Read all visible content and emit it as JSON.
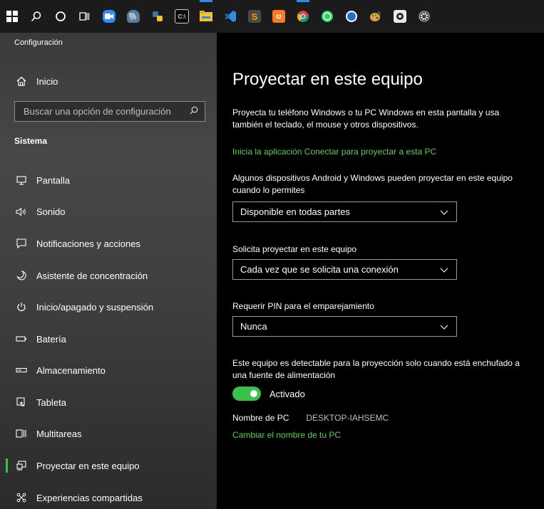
{
  "taskbar": {
    "icons": [
      {
        "name": "windows-start-icon",
        "color": "#ffffff"
      },
      {
        "name": "search-icon",
        "color": "#ffffff"
      },
      {
        "name": "cortana-icon",
        "color": "#ffffff"
      },
      {
        "name": "task-view-icon",
        "color": "#ffffff"
      },
      {
        "name": "zoom-icon",
        "color": "#2d8cff"
      },
      {
        "name": "pgadmin-icon",
        "color": "#4f7ca3"
      },
      {
        "name": "python-icon",
        "color": "#3b77a8"
      },
      {
        "name": "terminal-icon",
        "color": "#cfcfcf"
      },
      {
        "name": "file-explorer-icon",
        "color": "#f2c230"
      },
      {
        "name": "vscode-icon",
        "color": "#2f8de4"
      },
      {
        "name": "sublime-text-icon",
        "color": "#ff9800"
      },
      {
        "name": "xampp-icon",
        "color": "#fb7a24"
      },
      {
        "name": "chrome-icon",
        "color": "#e4a11b"
      },
      {
        "name": "whatsapp-icon",
        "color": "#25d366"
      },
      {
        "name": "app-blue-icon",
        "color": "#1e6fd9"
      },
      {
        "name": "paint-icon",
        "color": "#d9a441"
      },
      {
        "name": "obs-icon",
        "color": "#3a3a3a"
      },
      {
        "name": "settings-gear-icon",
        "color": "#dddddd"
      }
    ]
  },
  "sidebar": {
    "app_title": "Configuración",
    "home_label": "Inicio",
    "search_placeholder": "Buscar una opción de configuración",
    "section_heading": "Sistema",
    "items": [
      {
        "label": "Pantalla",
        "icon": "monitor-icon"
      },
      {
        "label": "Sonido",
        "icon": "speaker-icon"
      },
      {
        "label": "Notificaciones y acciones",
        "icon": "notification-icon"
      },
      {
        "label": "Asistente de concentración",
        "icon": "moon-icon"
      },
      {
        "label": "Inicio/apagado y suspensión",
        "icon": "power-icon"
      },
      {
        "label": "Batería",
        "icon": "battery-icon"
      },
      {
        "label": "Almacenamiento",
        "icon": "storage-icon"
      },
      {
        "label": "Tableta",
        "icon": "tablet-icon"
      },
      {
        "label": "Multitareas",
        "icon": "multitask-icon"
      },
      {
        "label": "Proyectar en este equipo",
        "icon": "project-icon",
        "selected": true
      },
      {
        "label": "Experiencias compartidas",
        "icon": "shared-icon"
      }
    ]
  },
  "main": {
    "title": "Proyectar en este equipo",
    "description": "Proyecta tu teléfono Windows o tu PC Windows en esta pantalla y usa también el teclado, el mouse y otros dispositivos.",
    "connect_link": "Inicia la aplicación Conectar para proyectar a esta PC",
    "availability_label": "Algunos dispositivos Android y Windows pueden proyectar en este equipo cuando lo permites",
    "availability_value": "Disponible en todas partes",
    "ask_label": "Solicita proyectar en este equipo",
    "ask_value": "Cada vez que se solicita una conexión",
    "pin_label": "Requerir PIN para el emparejamiento",
    "pin_value": "Nunca",
    "power_label": "Este equipo es detectable para la proyección solo cuando está enchufado a una fuente de alimentación",
    "toggle_state": "Activado",
    "pc_name_label": "Nombre de PC",
    "pc_name_value": "DESKTOP-IAHSEMC",
    "rename_link": "Cambiar el nombre de tu PC"
  },
  "colors": {
    "accent": "#37c24b",
    "link": "#5bd04e"
  }
}
